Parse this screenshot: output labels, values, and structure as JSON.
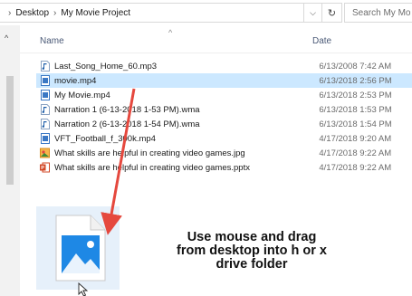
{
  "address": {
    "crumbs": [
      "Desktop",
      "My Movie Project"
    ],
    "dropdown_glyph": "⌵",
    "refresh_glyph": "↻",
    "search_placeholder": "Search My Mo"
  },
  "columns": {
    "name": "Name",
    "date": "Date"
  },
  "files": [
    {
      "name": "Last_Song_Home_60.mp3",
      "date": "6/13/2008 7:42 AM",
      "icon": "audio-file-icon",
      "selected": false
    },
    {
      "name": "movie.mp4",
      "date": "6/13/2018 2:56 PM",
      "icon": "video-file-icon",
      "selected": true
    },
    {
      "name": "My Movie.mp4",
      "date": "6/13/2018 2:53 PM",
      "icon": "video-file-icon",
      "selected": false
    },
    {
      "name": "Narration 1 (6-13-2018 1-53 PM).wma",
      "date": "6/13/2018 1:53 PM",
      "icon": "audio-file-icon",
      "selected": false
    },
    {
      "name": "Narration 2 (6-13-2018 1-54 PM).wma",
      "date": "6/13/2018 1:54 PM",
      "icon": "audio-file-icon",
      "selected": false
    },
    {
      "name": "VFT_Football_f_300k.mp4",
      "date": "4/17/2018 9:20 AM",
      "icon": "video-file-icon",
      "selected": false
    },
    {
      "name": "What skills are helpful in creating video games.jpg",
      "date": "4/17/2018 9:22 AM",
      "icon": "image-file-icon",
      "selected": false
    },
    {
      "name": "What skills are helpful in creating video games.pptx",
      "date": "4/17/2018 9:22 AM",
      "icon": "powerpoint-file-icon",
      "selected": false
    }
  ],
  "annotation": {
    "lines": [
      "Use mouse and drag",
      "from desktop into h or x",
      "drive folder"
    ]
  },
  "colors": {
    "selection": "#cce8ff",
    "arrow": "#e5483e",
    "accent": "#1e88e5",
    "ppt": "#d24726"
  }
}
